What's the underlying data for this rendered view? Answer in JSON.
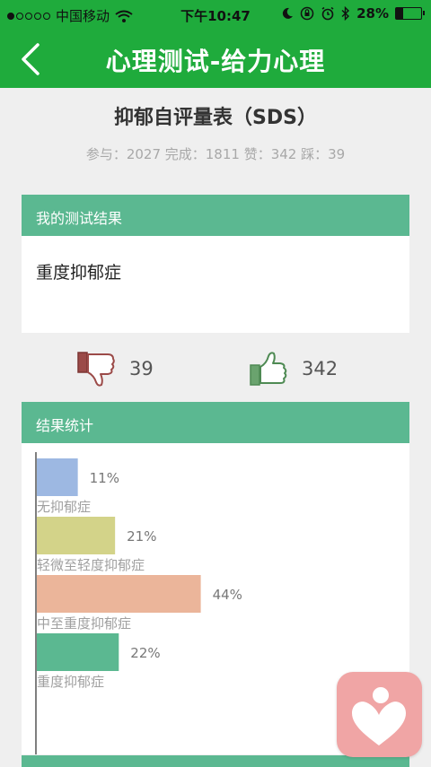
{
  "status_bar": {
    "carrier": "中国移动",
    "time": "下午10:47",
    "battery": "28%",
    "battery_level": 0.28,
    "signal_bars": 1
  },
  "nav": {
    "title": "心理测试-给力心理"
  },
  "test": {
    "title": "抑郁自评量表（SDS）",
    "stats": "参与：2027 完成：1811 赞：342 踩：39"
  },
  "result": {
    "header": "我的测试结果",
    "text": "重度抑郁症"
  },
  "votes": {
    "dislike_count": "39",
    "like_count": "342"
  },
  "statistics": {
    "header": "结果统计"
  },
  "chart_data": {
    "type": "bar",
    "orientation": "horizontal",
    "categories": [
      "无抑郁症",
      "轻微至轻度抑郁症",
      "中至重度抑郁症",
      "重度抑郁症"
    ],
    "values": [
      11,
      21,
      44,
      22
    ],
    "value_labels": [
      "11%",
      "21%",
      "44%",
      "22%"
    ],
    "colors": [
      "#9db8e2",
      "#d3d389",
      "#ebb59a",
      "#5bb891"
    ],
    "unit": "%"
  },
  "colors": {
    "brand": "#1fab3c",
    "card_header": "#5bb891",
    "float_button": "#f0a5a5"
  },
  "icons": {
    "back": "chevron-left-icon",
    "dislike": "thumbs-down-icon",
    "like": "thumbs-up-icon",
    "float": "heart-person-icon"
  }
}
